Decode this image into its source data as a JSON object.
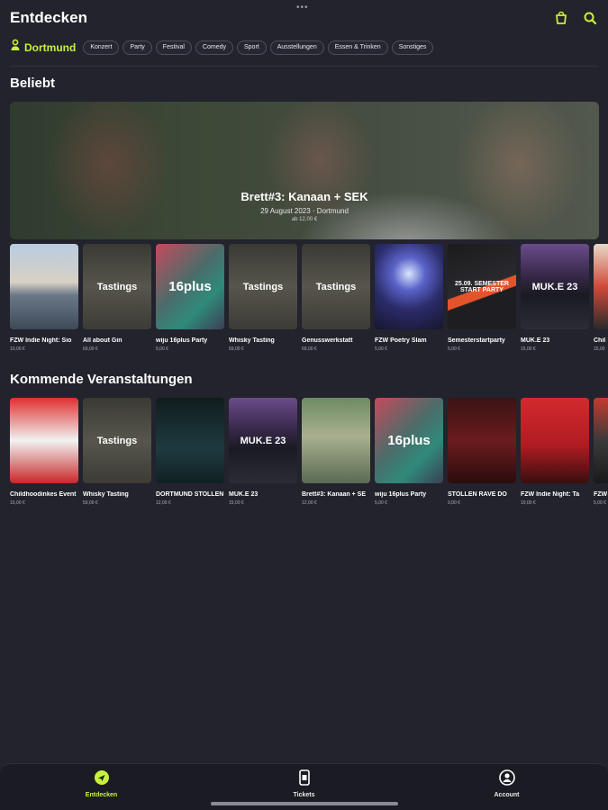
{
  "header": {
    "title": "Entdecken"
  },
  "filters": {
    "location": "Dortmund",
    "chips": [
      "Konzert",
      "Party",
      "Festival",
      "Comedy",
      "Sport",
      "Ausstellungen",
      "Essen & Trinken",
      "Sonstiges"
    ]
  },
  "popular": {
    "title": "Beliebt",
    "hero": {
      "title": "Brett#3: Kanaan + SEK",
      "meta": "29 August 2023 · Dortmund",
      "price": "ab 12,00 €"
    },
    "cards": [
      {
        "title": "FZW Indie Night: Sio",
        "price": "10,00 €",
        "style": "t-beach",
        "text": ""
      },
      {
        "title": "All about Gin",
        "price": "69,00 €",
        "style": "t-tasting",
        "text": "Tastings"
      },
      {
        "title": "wiju 16plus Party",
        "price": "5,00 €",
        "style": "t-16plus",
        "text": "16plus"
      },
      {
        "title": "Whisky Tasting",
        "price": "59,00 €",
        "style": "t-tasting",
        "text": "Tastings"
      },
      {
        "title": "Genusswerkstatt",
        "price": "69,00 €",
        "style": "t-tasting",
        "text": "Tastings"
      },
      {
        "title": "FZW Poetry Slam",
        "price": "5,00 €",
        "style": "t-stage",
        "text": ""
      },
      {
        "title": "Semesterstartparty",
        "price": "5,00 €",
        "style": "t-semester",
        "text": "25.09. SEMESTER START PARTY"
      },
      {
        "title": "MUK.E 23",
        "price": "15,00 €",
        "style": "t-muke",
        "text": "MUK.E 23"
      },
      {
        "title": "Chil",
        "price": "15,00",
        "style": "t-partial",
        "text": ""
      }
    ]
  },
  "upcoming": {
    "title": "Kommende Veranstaltungen",
    "cards": [
      {
        "title": "Childhoodinkes Event",
        "price": "15,00 €",
        "style": "t-red",
        "text": ""
      },
      {
        "title": "Whisky Tasting",
        "price": "59,00 €",
        "style": "t-tasting",
        "text": "Tastings"
      },
      {
        "title": "DORTMUND STOLLEN",
        "price": "12,00 €",
        "style": "t-dark-teal",
        "text": ""
      },
      {
        "title": "MUK.E 23",
        "price": "15,00 €",
        "style": "t-muke",
        "text": "MUK.E 23"
      },
      {
        "title": "Brett#3: Kanaan + SE",
        "price": "12,00 €",
        "style": "t-garden",
        "text": ""
      },
      {
        "title": "wiju 16plus Party",
        "price": "5,00 €",
        "style": "t-16plus",
        "text": "16plus"
      },
      {
        "title": "STOLLEN RAVE DO",
        "price": "9,00 €",
        "style": "t-darkred",
        "text": ""
      },
      {
        "title": "FZW Indie Night: Ta",
        "price": "10,00 €",
        "style": "t-redband",
        "text": ""
      },
      {
        "title": "FZW",
        "price": "5,00 €",
        "style": "t-mixed",
        "text": ""
      }
    ]
  },
  "nav": {
    "items": [
      {
        "label": "Entdecken",
        "icon": "compass-icon",
        "active": true
      },
      {
        "label": "Tickets",
        "icon": "ticket-icon",
        "active": false
      },
      {
        "label": "Account",
        "icon": "account-icon",
        "active": false
      }
    ]
  },
  "colors": {
    "background": "#22232c",
    "accent": "#c8f03c",
    "chip_border": "#4e4f5a"
  }
}
